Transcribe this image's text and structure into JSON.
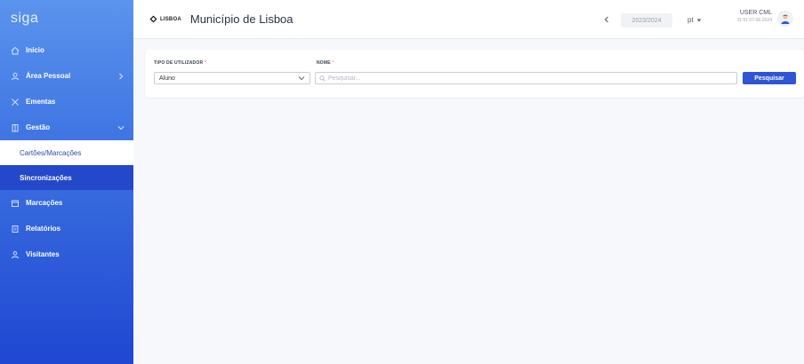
{
  "sidebar": {
    "brand": "siga",
    "items": [
      {
        "label": "Início",
        "icon": "home-icon"
      },
      {
        "label": "Área Pessoal",
        "icon": "user-icon",
        "chevron": "right"
      },
      {
        "label": "Ementas",
        "icon": "cutlery-icon"
      },
      {
        "label": "Gestão",
        "icon": "folder-icon",
        "chevron": "down"
      }
    ],
    "sub_items": [
      {
        "label": "Cartões/Marcações",
        "state": "active"
      },
      {
        "label": "Sincronizações",
        "state": "dark"
      }
    ],
    "items_after": [
      {
        "label": "Marcações",
        "icon": "calendar-icon"
      },
      {
        "label": "Relatórios",
        "icon": "report-icon"
      },
      {
        "label": "Visitantes",
        "icon": "visitors-icon"
      }
    ]
  },
  "header": {
    "logo_text": "LISBOA",
    "title": "Município de Lisboa",
    "school_year": "2023/2024",
    "language": "pt",
    "user_name": "USER CML",
    "user_datetime": "11:51 07-06-2024"
  },
  "filters": {
    "user_type_label": "TIPO DE UTILIZADOR",
    "user_type_value": "Aluno",
    "name_label": "NOME",
    "name_placeholder": "Pesquisar...",
    "required_mark": "*",
    "search_button": "Pesquisar"
  },
  "colors": {
    "accent": "#2f55d4",
    "sidebar_top": "#5b94ee",
    "sidebar_bottom": "#1f47d2"
  }
}
